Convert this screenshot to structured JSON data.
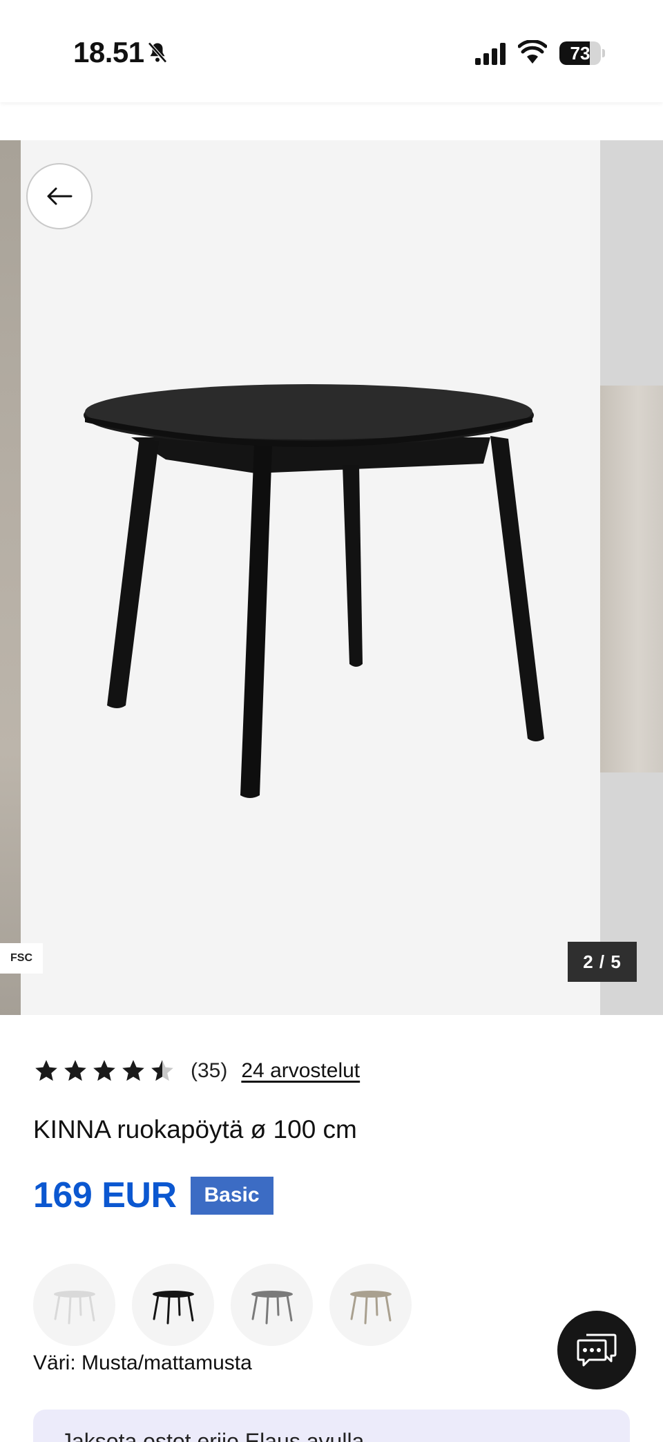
{
  "status_bar": {
    "time": "18.51",
    "battery_level": "73",
    "battery_fraction": 0.73
  },
  "gallery": {
    "fsc_badge": "FSC",
    "counter": "2 / 5",
    "table_color": "#111111"
  },
  "product": {
    "rating": 4.5,
    "rating_count": "(35)",
    "reviews_link": "24 arvostelut",
    "title": "KINNA ruokapöytä ø 100 cm",
    "price": "169 EUR",
    "tier_badge": "Basic",
    "price_color": "#0b57d0",
    "badge_color": "#3c6cc4"
  },
  "color_options": {
    "swatches": [
      {
        "name": "white",
        "color": "#d9d9d9"
      },
      {
        "name": "black",
        "color": "#151515"
      },
      {
        "name": "grey",
        "color": "#7a7a7a"
      },
      {
        "name": "beige",
        "color": "#a9a08f"
      }
    ],
    "selected_label": "Väri: Musta/mattamusta"
  },
  "info_box": {
    "text": "Jaksota ostot erijo Elaus avulla"
  },
  "icons": {
    "back": "arrow-left-icon",
    "chat": "chat-bubble-icon",
    "bell": "bell-slash-icon",
    "signal": "signal-icon",
    "wifi": "wifi-icon"
  }
}
